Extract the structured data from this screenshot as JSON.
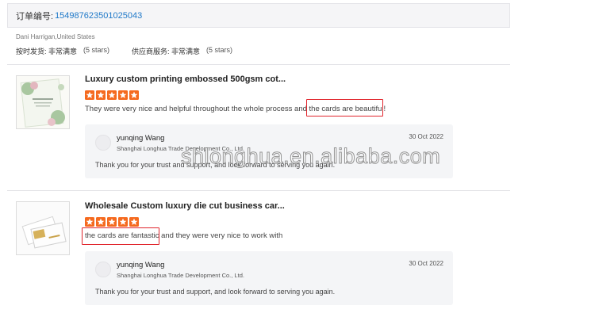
{
  "order": {
    "label": "订单编号:",
    "number": "154987623501025043"
  },
  "buyer": {
    "name_location": "Dani Harrigan,United States"
  },
  "ratings": [
    {
      "label": "按时发货: 非常满意",
      "stars_text": "(5 stars)"
    },
    {
      "label": "供应商服务: 非常满意",
      "stars_text": "(5 stars)"
    }
  ],
  "reviews": [
    {
      "title": "Luxury custom printing embossed 500gsm cot...",
      "rating": 5,
      "comment": "They were very nice and helpful throughout the whole process and the cards are beautiful!",
      "reply": {
        "name": "yunqing Wang",
        "company": "Shanghai Longhua Trade Development Co., Ltd.",
        "date": "30 Oct 2022",
        "message": "Thank you for your trust and support, and look forward to serving you again."
      }
    },
    {
      "title": "Wholesale Custom luxury die cut business car...",
      "rating": 5,
      "comment": "the cards are fantastic and they were very nice to work with",
      "reply": {
        "name": "yunqing Wang",
        "company": "Shanghai Longhua Trade Development Co., Ltd.",
        "date": "30 Oct 2022",
        "message": "Thank you for your trust and support, and look forward to serving you again."
      }
    }
  ],
  "watermark": "shlonghua.en.alibaba.com",
  "colors": {
    "star": "#f56a1f",
    "highlight": "#e0242b",
    "order_link": "#1e78c8"
  },
  "icons": [
    "star-icon",
    "avatar-icon"
  ]
}
